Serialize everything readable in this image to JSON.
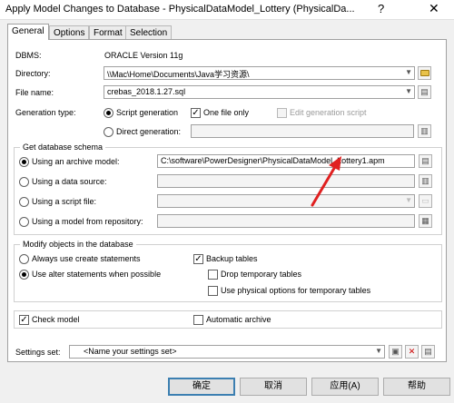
{
  "window": {
    "title": "Apply Model Changes to Database - PhysicalDataModel_Lottery (PhysicalDa...",
    "help_glyph": "?",
    "close_glyph": "✕"
  },
  "tabs": [
    "General",
    "Options",
    "Format",
    "Selection"
  ],
  "general": {
    "dbms_label": "DBMS:",
    "dbms_value": "ORACLE Version 11g",
    "directory_label": "Directory:",
    "directory_value": "\\\\Mac\\Home\\Documents\\Java学习资源\\",
    "filename_label": "File name:",
    "filename_value": "crebas_2018.1.27.sql",
    "generation_type_label": "Generation type:",
    "script_generation": "Script generation",
    "one_file_only": "One file only",
    "edit_generation_script": "Edit generation script",
    "direct_generation": "Direct generation:"
  },
  "schema": {
    "title": "Get database schema",
    "archive_label": "Using an archive model:",
    "archive_value": "C:\\software\\PowerDesigner\\PhysicalDataModel_Lottery1.apm",
    "datasource_label": "Using a data source:",
    "scriptfile_label": "Using a script file:",
    "repository_label": "Using a model from repository:"
  },
  "modify": {
    "title": "Modify objects in the database",
    "always_create": "Always use create statements",
    "use_alter": "Use alter statements when possible",
    "backup_tables": "Backup tables",
    "drop_temp": "Drop temporary tables",
    "physical_options": "Use physical options for temporary tables"
  },
  "checks": {
    "check_model": "Check model",
    "automatic_archive": "Automatic archive"
  },
  "settings": {
    "label": "Settings set:",
    "value": "<Name your settings set>"
  },
  "buttons": {
    "ok": "确定",
    "cancel": "取消",
    "apply": "应用(A)",
    "help": "帮助"
  },
  "colors": {
    "annotation_arrow": "#e02020",
    "default_button_border": "#3c7fb1"
  }
}
